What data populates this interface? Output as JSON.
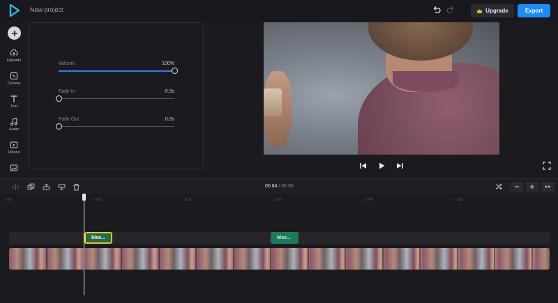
{
  "header": {
    "project_title": "New project",
    "upgrade_label": "Upgrade",
    "export_label": "Export"
  },
  "sidebar": {
    "items": [
      {
        "label": "Uploads",
        "icon": "upload-cloud-icon"
      },
      {
        "label": "Canvas",
        "icon": "canvas-icon"
      },
      {
        "label": "Text",
        "icon": "text-icon"
      },
      {
        "label": "Audio",
        "icon": "music-note-icon"
      },
      {
        "label": "Videos",
        "icon": "video-icon"
      },
      {
        "label": "",
        "icon": "image-icon"
      }
    ]
  },
  "properties": {
    "volume": {
      "label": "Volume",
      "value": "100%",
      "level": 1.0
    },
    "fade_in": {
      "label": "Fade In",
      "value": "0.0s",
      "level": 0.0
    },
    "fade_out": {
      "label": "Fade Out",
      "value": "0.0s",
      "level": 0.0
    }
  },
  "timeline": {
    "current_time": "00.84",
    "separator": "/",
    "duration": "06.00",
    "ruler_ticks": [
      "0:00",
      "0:01",
      "0:02",
      "0:03",
      "0:04",
      "0:05"
    ],
    "clips": [
      {
        "label": "blee...",
        "selected": true
      },
      {
        "label": "blee...",
        "selected": false
      }
    ]
  },
  "colors": {
    "accent": "#1a8cff",
    "selection": "#f3c21b",
    "audio_clip": "#1f6b4d"
  }
}
